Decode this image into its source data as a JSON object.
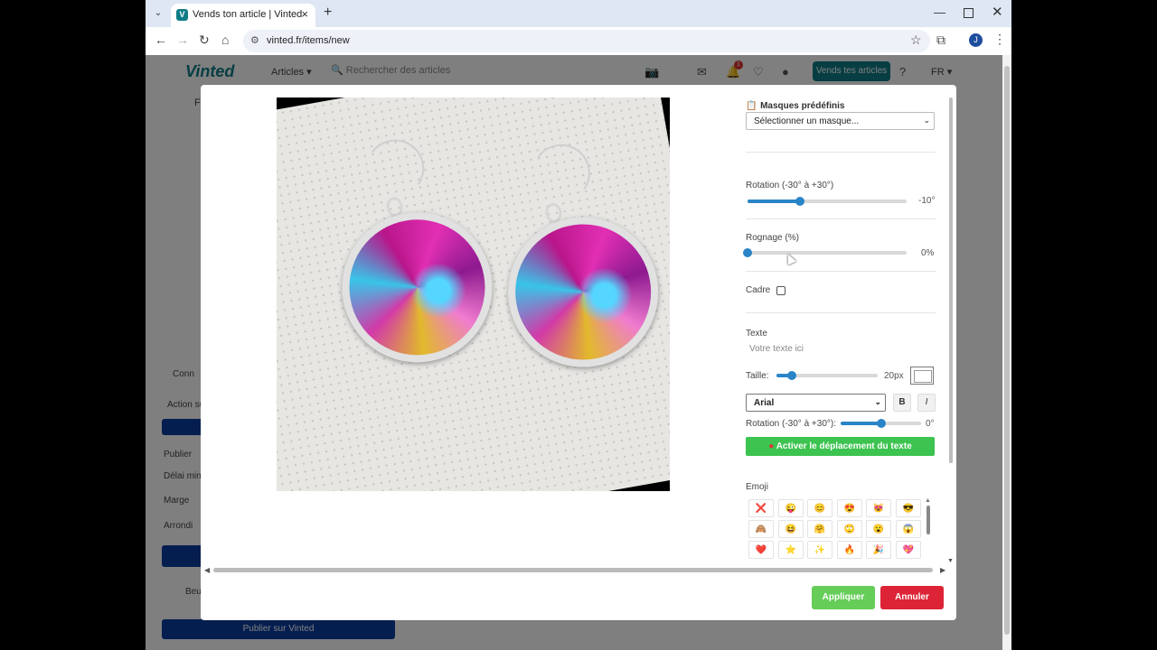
{
  "browser": {
    "tab_title": "Vends ton article | Vinted",
    "favicon_letter": "V",
    "url": "vinted.fr/items/new",
    "profile_initial": "J"
  },
  "site": {
    "logo": "Vinted",
    "category": "Articles",
    "search_placeholder": "Rechercher des articles",
    "notif_count": "1",
    "sell_button": "Vends tes articles",
    "lang": "FR",
    "section_letter": "F",
    "side_items": [
      "Conn",
      "Action su",
      "Publier",
      "Publier",
      "Délai mini",
      "Marge",
      "Arrondi",
      "Beu",
      "Publier sur Vinted"
    ]
  },
  "editor": {
    "masks_label": "Masques prédéfinis",
    "masks_select": "Sélectionner un masque...",
    "rotation_label": "Rotation (-30° à +30°)",
    "rotation_value": "-10°",
    "rotation_fraction": 0.33,
    "crop_label": "Rognage (%)",
    "crop_value": "0%",
    "crop_fraction": 0,
    "frame_label": "Cadre",
    "text_label": "Texte",
    "text_placeholder": "Votre texte ici",
    "size_label": "Taille:",
    "size_value": "20px",
    "size_fraction": 0.15,
    "font_select": "Arial",
    "bold_btn": "B",
    "italic_btn": "I",
    "text_rotation_label": "Rotation (-30° à +30°):",
    "text_rotation_value": "0°",
    "text_rotation_fraction": 0.5,
    "move_text_btn": "Activer le déplacement du texte",
    "emoji_label": "Emoji",
    "emojis": [
      "❌",
      "😜",
      "😊",
      "😍",
      "😻",
      "😎",
      "🙈",
      "😆",
      "🤗",
      "🙄",
      "😮",
      "😱",
      "❤️",
      "⭐",
      "✨",
      "🔥",
      "🎉",
      "💖"
    ],
    "apply_btn": "Appliquer",
    "cancel_btn": "Annuler"
  },
  "colors": {
    "brand": "#0e7c86",
    "slider": "#2a85c8",
    "green": "#3cc350",
    "apply": "#66cd59",
    "cancel": "#dd2436"
  }
}
